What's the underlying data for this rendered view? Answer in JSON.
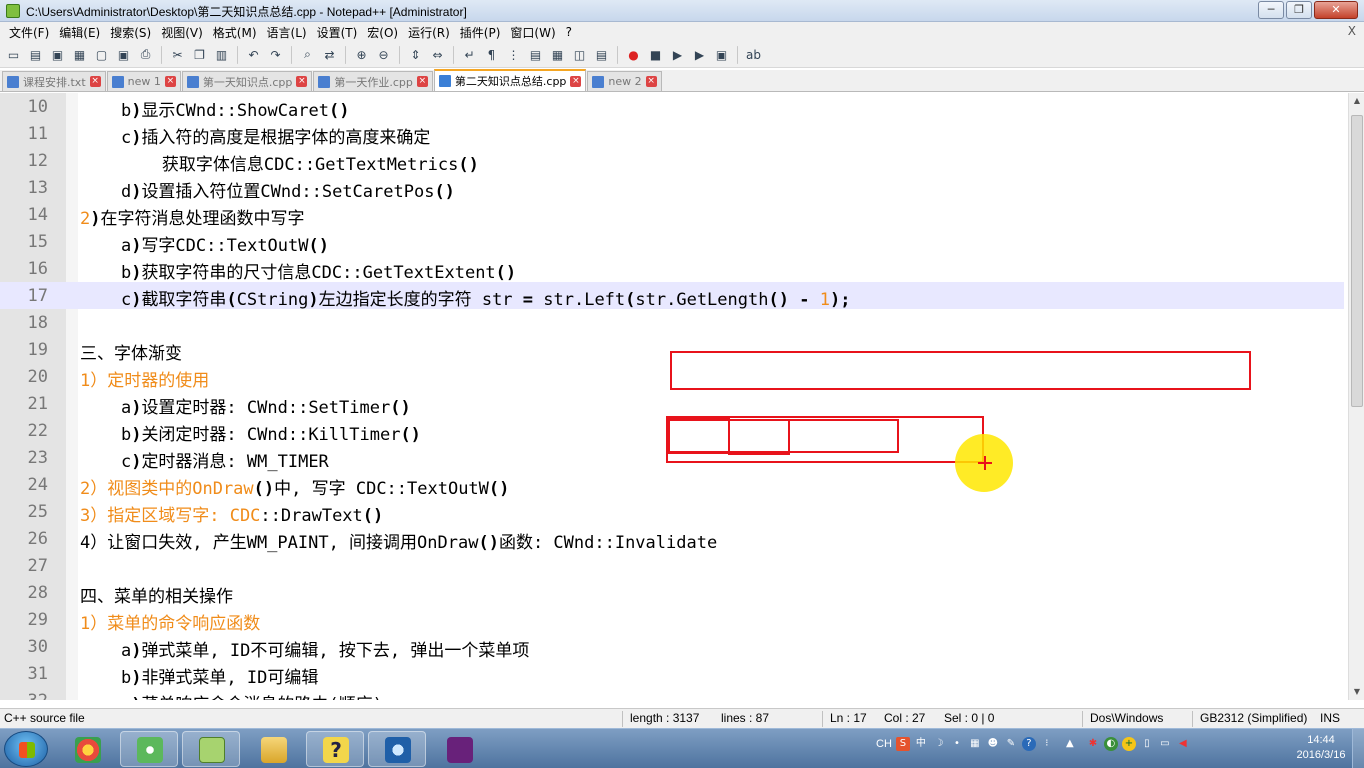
{
  "window": {
    "title": "C:\\Users\\Administrator\\Desktop\\第二天知识点总结.cpp - Notepad++ [Administrator]",
    "controls": [
      "─",
      "❐",
      "✕"
    ]
  },
  "menu": [
    "文件(F)",
    "编辑(E)",
    "搜索(S)",
    "视图(V)",
    "格式(M)",
    "语言(L)",
    "设置(T)",
    "宏(O)",
    "运行(R)",
    "插件(P)",
    "窗口(W)",
    "?"
  ],
  "menu_close": "X",
  "toolbar_icons": [
    "new-icon",
    "open-icon",
    "save-icon",
    "save-all-icon",
    "close-icon",
    "close-all-icon",
    "print-icon",
    "cut-icon",
    "copy-icon",
    "paste-icon",
    "undo-icon",
    "redo-icon",
    "find-icon",
    "replace-icon",
    "zoom-in-icon",
    "zoom-out-icon",
    "sync-v-icon",
    "sync-h-icon",
    "wrap-icon",
    "show-all-chars-icon",
    "indent-guide-icon",
    "udl-icon",
    "doc-map-icon",
    "func-list-icon",
    "folder-icon",
    "record-macro-icon",
    "stop-record-icon",
    "play-macro-icon",
    "run-macro-multiple-icon",
    "save-macro-icon",
    "spellcheck-icon"
  ],
  "tabs": [
    {
      "label": "课程安排.txt",
      "active": false
    },
    {
      "label": "new 1",
      "active": false
    },
    {
      "label": "第一天知识点.cpp",
      "active": false
    },
    {
      "label": "第一天作业.cpp",
      "active": false
    },
    {
      "label": "第二天知识点总结.cpp",
      "active": true
    },
    {
      "label": "new 2",
      "active": false
    }
  ],
  "lines": [
    {
      "n": "10",
      "parts": [
        {
          "t": "    b"
        },
        {
          "t": ")",
          "c": "bold"
        },
        {
          "t": "显示CWnd::ShowCaret"
        },
        {
          "t": "()",
          "c": "bold"
        }
      ]
    },
    {
      "n": "11",
      "parts": [
        {
          "t": "    c"
        },
        {
          "t": ")",
          "c": "bold"
        },
        {
          "t": "插入符的高度是根据字体的高度来确定"
        }
      ]
    },
    {
      "n": "12",
      "parts": [
        {
          "t": "        获取字体信息CDC::GetTextMetrics"
        },
        {
          "t": "()",
          "c": "bold"
        }
      ]
    },
    {
      "n": "13",
      "parts": [
        {
          "t": "    d"
        },
        {
          "t": ")",
          "c": "bold"
        },
        {
          "t": "设置插入符位置CWnd::SetCaretPos"
        },
        {
          "t": "()",
          "c": "bold"
        }
      ]
    },
    {
      "n": "14",
      "parts": [
        {
          "t": "2",
          "c": "orange"
        },
        {
          "t": ")",
          "c": "bold"
        },
        {
          "t": "在字符消息处理函数中写字"
        }
      ]
    },
    {
      "n": "15",
      "parts": [
        {
          "t": "    a"
        },
        {
          "t": ")",
          "c": "bold"
        },
        {
          "t": "写字CDC::TextOutW"
        },
        {
          "t": "()",
          "c": "bold"
        }
      ]
    },
    {
      "n": "16",
      "parts": [
        {
          "t": "    b"
        },
        {
          "t": ")",
          "c": "bold"
        },
        {
          "t": "获取字符串的尺寸信息CDC::GetTextExtent"
        },
        {
          "t": "()",
          "c": "bold"
        }
      ]
    },
    {
      "n": "17",
      "current": true,
      "parts": [
        {
          "t": "    c"
        },
        {
          "t": ")",
          "c": "bold"
        },
        {
          "t": "截取字符串"
        },
        {
          "t": "(",
          "c": "bold"
        },
        {
          "t": "CString"
        },
        {
          "t": ")",
          "c": "bold"
        },
        {
          "t": "左边指定长度的字符 str "
        },
        {
          "t": "=",
          "c": "bold"
        },
        {
          "t": " str.Left"
        },
        {
          "t": "(",
          "c": "bold"
        },
        {
          "t": "str.GetLength"
        },
        {
          "t": "()",
          "c": "bold"
        },
        {
          "t": " "
        },
        {
          "t": "-",
          "c": "bold"
        },
        {
          "t": " "
        },
        {
          "t": "1",
          "c": "orange"
        },
        {
          "t": ");",
          "c": "bold"
        }
      ]
    },
    {
      "n": "18",
      "parts": [
        {
          "t": ""
        }
      ]
    },
    {
      "n": "19",
      "parts": [
        {
          "t": "三、字体渐变"
        }
      ]
    },
    {
      "n": "20",
      "parts": [
        {
          "t": "1）定时器的使用",
          "c": "orange"
        }
      ]
    },
    {
      "n": "21",
      "parts": [
        {
          "t": "    a"
        },
        {
          "t": ")",
          "c": "bold"
        },
        {
          "t": "设置定时器: CWnd::SetTimer"
        },
        {
          "t": "()",
          "c": "bold"
        }
      ]
    },
    {
      "n": "22",
      "parts": [
        {
          "t": "    b"
        },
        {
          "t": ")",
          "c": "bold"
        },
        {
          "t": "关闭定时器: CWnd::KillTimer"
        },
        {
          "t": "()",
          "c": "bold"
        }
      ]
    },
    {
      "n": "23",
      "parts": [
        {
          "t": "    c"
        },
        {
          "t": ")",
          "c": "bold"
        },
        {
          "t": "定时器消息: WM_TIMER"
        }
      ]
    },
    {
      "n": "24",
      "parts": [
        {
          "t": "2）视图类中的OnDraw",
          "c": "orange"
        },
        {
          "t": "()",
          "c": "bold"
        },
        {
          "t": "中, 写字 CDC::TextOutW"
        },
        {
          "t": "()",
          "c": "bold"
        }
      ]
    },
    {
      "n": "25",
      "parts": [
        {
          "t": "3）指定区域写字: CDC",
          "c": "orange"
        },
        {
          "t": "::DrawText"
        },
        {
          "t": "()",
          "c": "bold"
        }
      ]
    },
    {
      "n": "26",
      "parts": [
        {
          "t": "4）让窗口失效, 产生WM_PAINT, 间接调用OnDraw"
        },
        {
          "t": "()",
          "c": "bold"
        },
        {
          "t": "函数: CWnd::Invalidate"
        }
      ]
    },
    {
      "n": "27",
      "parts": [
        {
          "t": ""
        }
      ]
    },
    {
      "n": "28",
      "parts": [
        {
          "t": "四、菜单的相关操作"
        }
      ]
    },
    {
      "n": "29",
      "parts": [
        {
          "t": "1）菜单的命令响应函数",
          "c": "orange"
        }
      ]
    },
    {
      "n": "30",
      "parts": [
        {
          "t": "    a"
        },
        {
          "t": ")",
          "c": "bold"
        },
        {
          "t": "弹式菜单, ID不可编辑, 按下去, 弹出一个菜单项"
        }
      ]
    },
    {
      "n": "31",
      "parts": [
        {
          "t": "    b"
        },
        {
          "t": ")",
          "c": "bold"
        },
        {
          "t": "非弹式菜单, ID可编辑"
        }
      ]
    },
    {
      "n": "32",
      "parts": [
        {
          "t": "    c"
        },
        {
          "t": ")",
          "c": "bold"
        },
        {
          "t": "菜单响应命令消息的路由(顺序)"
        }
      ]
    }
  ],
  "status": {
    "filetype": "C++ source file",
    "length": "length : 3137",
    "lines": "lines : 87",
    "ln": "Ln : 17",
    "col": "Col : 27",
    "sel": "Sel : 0 | 0",
    "eol": "Dos\\Windows",
    "encoding": "GB2312 (Simplified)",
    "mode": "INS"
  },
  "taskbar": {
    "apps": [
      "chrome-like-icon",
      "360-browser-icon",
      "notepadpp-icon",
      "explorer-icon",
      "help-icon",
      "screen-recorder-icon",
      "visual-studio-icon"
    ],
    "tray_lang": "CH",
    "clock_time": "14:44",
    "clock_date": "2016/3/16"
  }
}
